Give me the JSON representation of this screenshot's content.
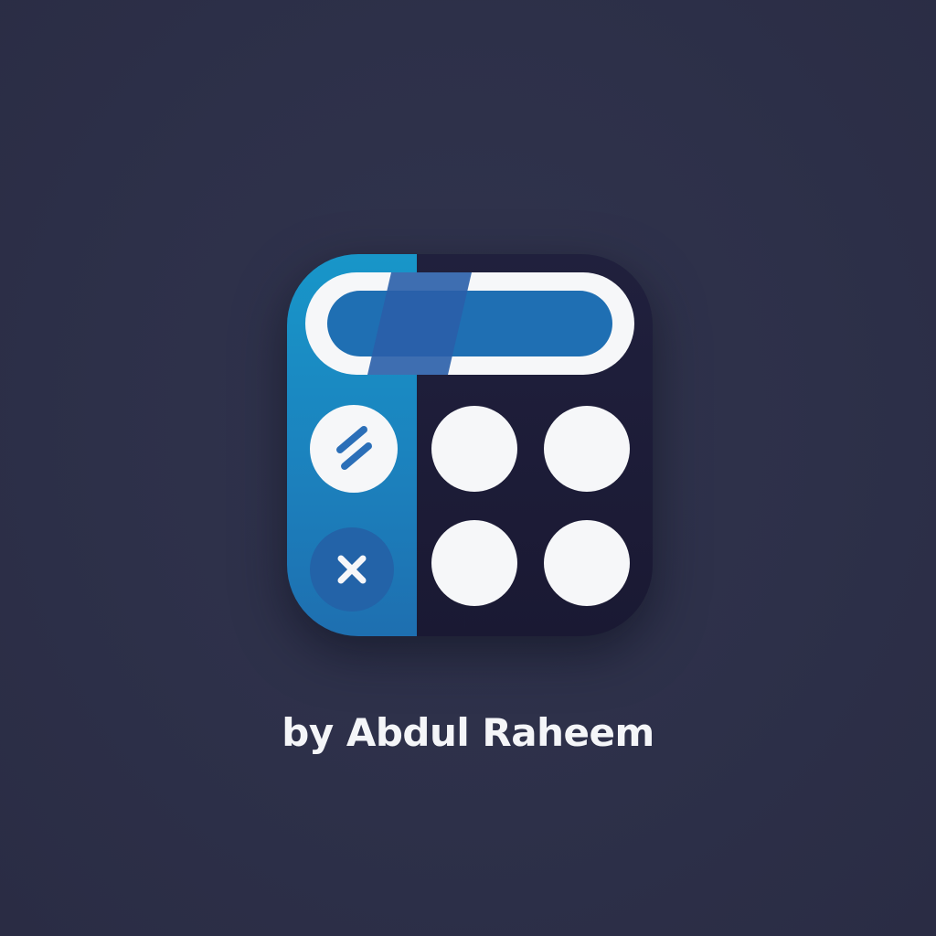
{
  "byline": "by Abdul Raheem",
  "icon": {
    "semantic": "calculator-app-icon",
    "colors": {
      "background": "#2d3049",
      "panel_left": "#1d86bf",
      "panel_right": "#1c1b37",
      "display_fill": "#1f6fb3",
      "display_stripe": "#2a5ea8",
      "button_white": "#f6f7f9",
      "button_blue": "#2363a8",
      "glyph_blue": "#2b6fb8"
    },
    "keys": [
      {
        "name": "divide-key",
        "glyph": "//"
      },
      {
        "name": "multiply-key",
        "glyph": "×"
      },
      {
        "name": "number-key-1",
        "glyph": ""
      },
      {
        "name": "number-key-2",
        "glyph": ""
      },
      {
        "name": "number-key-3",
        "glyph": ""
      },
      {
        "name": "number-key-4",
        "glyph": ""
      }
    ]
  }
}
